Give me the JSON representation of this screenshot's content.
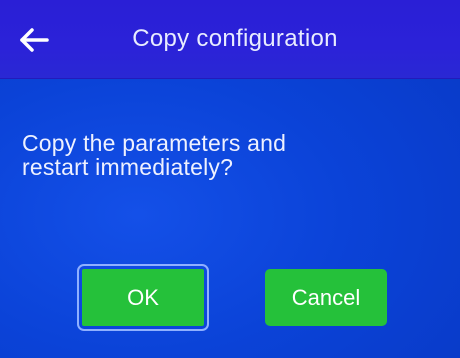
{
  "header": {
    "back_icon": "back-arrow-icon",
    "title": "Copy configuration"
  },
  "dialog": {
    "message_line_1": "Copy the parameters and",
    "message_line_2": "restart immediately?"
  },
  "buttons": {
    "ok_label": "OK",
    "cancel_label": "Cancel"
  },
  "colors": {
    "background": "#0b43d8",
    "header": "#2a22d6",
    "button": "#25c13a"
  }
}
